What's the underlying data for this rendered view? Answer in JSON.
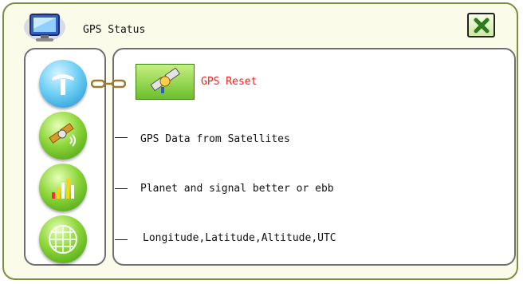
{
  "window": {
    "title": "GPS Status"
  },
  "icons": {
    "title": "computer-monitor-icon",
    "close": "close-icon",
    "reset": "satellite-icon",
    "menu": [
      "antenna-icon",
      "satellite-signal-icon",
      "signal-bars-icon",
      "globe-grid-icon"
    ]
  },
  "items": [
    {
      "label": "GPS Reset"
    },
    {
      "label": "GPS Data from Satellites"
    },
    {
      "label": "Planet and signal better or ebb"
    },
    {
      "label": "Longitude,Latitude,Altitude,UTC"
    }
  ],
  "colors": {
    "accent": "#ff1a1a",
    "green": "#6cbf2a",
    "blue": "#1d8fd1"
  }
}
